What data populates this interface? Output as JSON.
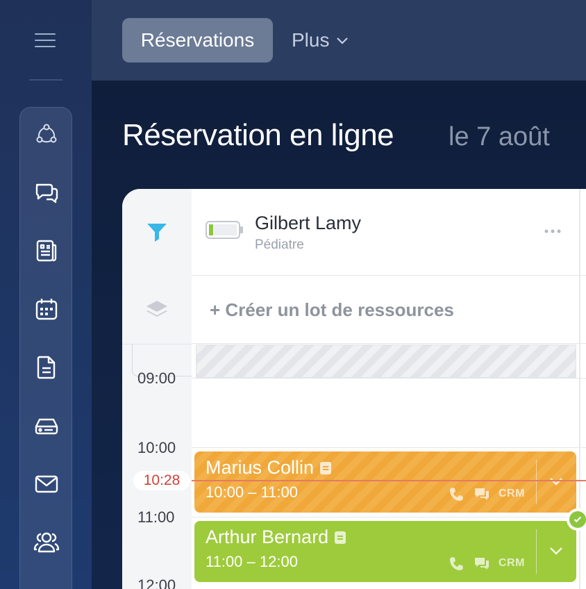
{
  "topbar": {
    "tab_active": "Réservations",
    "tab_more": "Plus"
  },
  "sidebar": {
    "items": [
      {
        "icon": "integrations-icon"
      },
      {
        "icon": "chat-icon"
      },
      {
        "icon": "news-icon"
      },
      {
        "icon": "calendar-icon"
      },
      {
        "icon": "document-icon"
      },
      {
        "icon": "drive-icon"
      },
      {
        "icon": "mail-icon"
      },
      {
        "icon": "users-icon"
      }
    ]
  },
  "page": {
    "title": "Réservation en ligne",
    "date": "le 7 août"
  },
  "resource": {
    "name": "Gilbert Lamy",
    "role": "Pédiatre",
    "create_batch": "+ Créer un lot de ressources"
  },
  "timeline": {
    "times": [
      "09:00",
      "10:00",
      "11:00",
      "12:00"
    ],
    "now": "10:28"
  },
  "events": [
    {
      "name": "Marius Collin",
      "time": "10:00 – 11:00",
      "crm": "CRM",
      "color": "#f0a83a"
    },
    {
      "name": "Arthur Bernard",
      "time": "11:00 – 12:00",
      "crm": "CRM",
      "color": "#9ecb3c"
    }
  ],
  "colors": {
    "accent_filter": "#3bb6e8",
    "now_line": "#e57a64",
    "now_text": "#d0423a"
  }
}
